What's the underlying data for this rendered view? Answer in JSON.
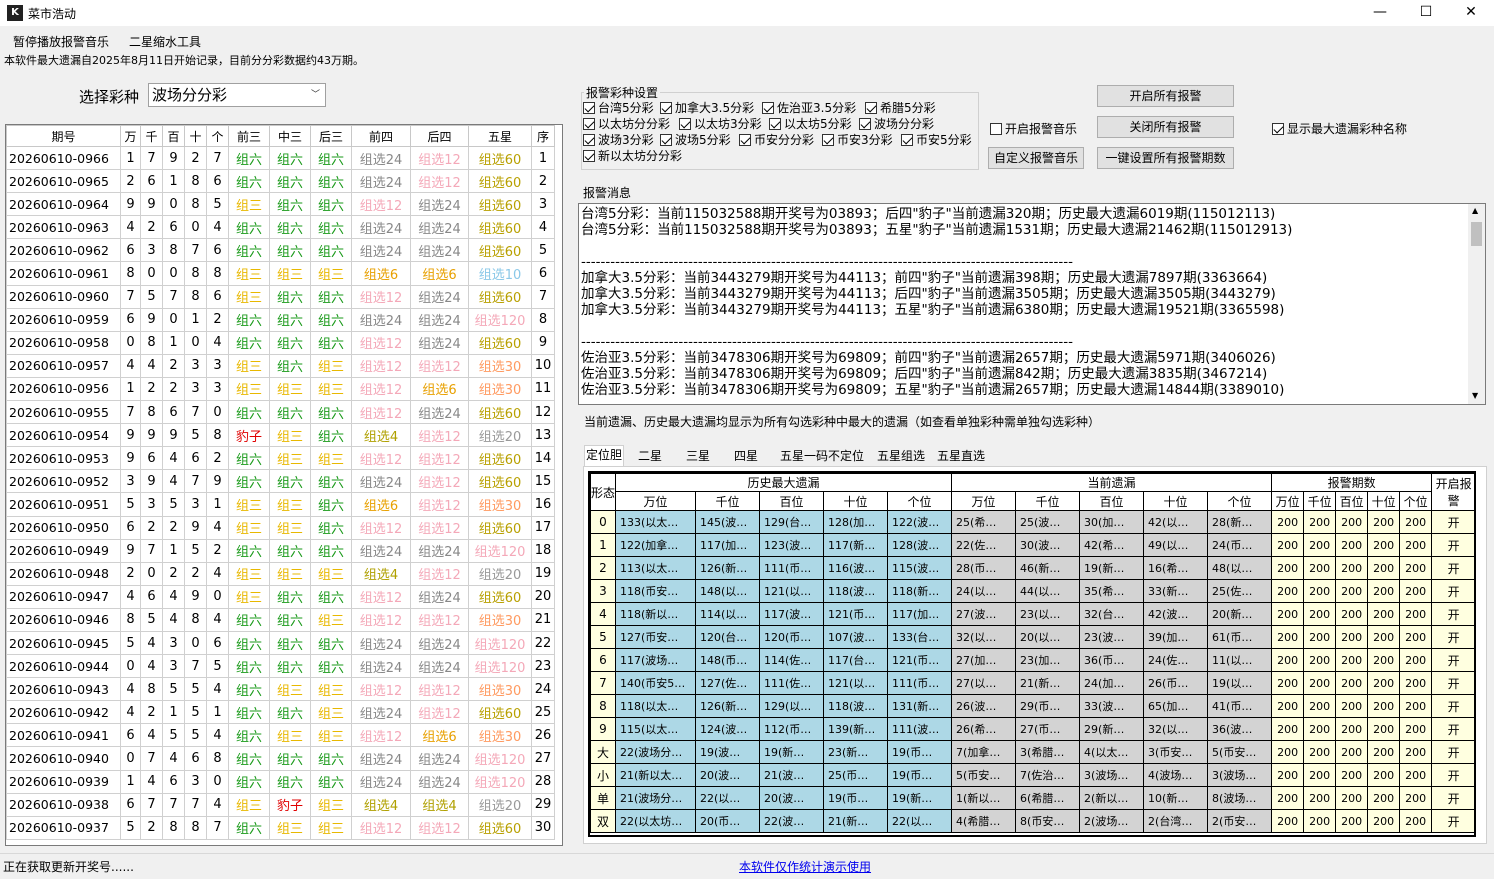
{
  "window": {
    "title": "菜市浩动",
    "minimize": "—",
    "maximize": "☐",
    "close": "✕"
  },
  "menu": [
    "暂停播放报警音乐",
    "二星缩水工具"
  ],
  "notice": "本软件最大遗漏自2025年8月11日开始记录，目前分分彩数据约43万期。",
  "selector": {
    "label": "选择彩种",
    "value": "波场分分彩"
  },
  "draws": {
    "headers": [
      "期号",
      "万",
      "千",
      "百",
      "十",
      "个",
      "前三",
      "中三",
      "后三",
      "前四",
      "后四",
      "五星",
      "序"
    ],
    "rows": [
      [
        "20260610-0966",
        "1",
        "7",
        "9",
        "2",
        "7",
        "组六",
        "组六",
        "组六",
        "组选24",
        "组选12",
        "组选60",
        "1"
      ],
      [
        "20260610-0965",
        "2",
        "6",
        "1",
        "8",
        "6",
        "组六",
        "组六",
        "组六",
        "组选24",
        "组选12",
        "组选60",
        "2"
      ],
      [
        "20260610-0964",
        "9",
        "9",
        "0",
        "8",
        "5",
        "组三",
        "组六",
        "组六",
        "组选12",
        "组选24",
        "组选60",
        "3"
      ],
      [
        "20260610-0963",
        "4",
        "2",
        "6",
        "0",
        "4",
        "组六",
        "组六",
        "组六",
        "组选24",
        "组选24",
        "组选60",
        "4"
      ],
      [
        "20260610-0962",
        "6",
        "3",
        "8",
        "7",
        "6",
        "组六",
        "组六",
        "组六",
        "组选24",
        "组选24",
        "组选60",
        "5"
      ],
      [
        "20260610-0961",
        "8",
        "0",
        "0",
        "8",
        "8",
        "组三",
        "组三",
        "组三",
        "组选6",
        "组选6",
        "组选10",
        "6"
      ],
      [
        "20260610-0960",
        "7",
        "5",
        "7",
        "8",
        "6",
        "组三",
        "组六",
        "组六",
        "组选12",
        "组选24",
        "组选60",
        "7"
      ],
      [
        "20260610-0959",
        "6",
        "9",
        "0",
        "1",
        "2",
        "组六",
        "组六",
        "组六",
        "组选24",
        "组选24",
        "组选120",
        "8"
      ],
      [
        "20260610-0958",
        "0",
        "8",
        "1",
        "0",
        "4",
        "组六",
        "组六",
        "组六",
        "组选12",
        "组选24",
        "组选60",
        "9"
      ],
      [
        "20260610-0957",
        "4",
        "4",
        "2",
        "3",
        "3",
        "组三",
        "组六",
        "组三",
        "组选12",
        "组选12",
        "组选30",
        "10"
      ],
      [
        "20260610-0956",
        "1",
        "2",
        "2",
        "3",
        "3",
        "组三",
        "组三",
        "组三",
        "组选12",
        "组选6",
        "组选30",
        "11"
      ],
      [
        "20260610-0955",
        "7",
        "8",
        "6",
        "7",
        "0",
        "组六",
        "组六",
        "组六",
        "组选12",
        "组选24",
        "组选60",
        "12"
      ],
      [
        "20260610-0954",
        "9",
        "9",
        "9",
        "5",
        "8",
        "豹子",
        "组三",
        "组六",
        "组选4",
        "组选12",
        "组选20",
        "13"
      ],
      [
        "20260610-0953",
        "9",
        "6",
        "4",
        "6",
        "2",
        "组六",
        "组三",
        "组三",
        "组选12",
        "组选12",
        "组选60",
        "14"
      ],
      [
        "20260610-0952",
        "3",
        "9",
        "4",
        "7",
        "9",
        "组六",
        "组六",
        "组六",
        "组选24",
        "组选12",
        "组选60",
        "15"
      ],
      [
        "20260610-0951",
        "5",
        "3",
        "5",
        "3",
        "1",
        "组三",
        "组三",
        "组六",
        "组选6",
        "组选12",
        "组选30",
        "16"
      ],
      [
        "20260610-0950",
        "6",
        "2",
        "2",
        "9",
        "4",
        "组三",
        "组三",
        "组六",
        "组选12",
        "组选12",
        "组选60",
        "17"
      ],
      [
        "20260610-0949",
        "9",
        "7",
        "1",
        "5",
        "2",
        "组六",
        "组六",
        "组六",
        "组选24",
        "组选24",
        "组选120",
        "18"
      ],
      [
        "20260610-0948",
        "2",
        "0",
        "2",
        "2",
        "4",
        "组三",
        "组三",
        "组三",
        "组选4",
        "组选12",
        "组选20",
        "19"
      ],
      [
        "20260610-0947",
        "4",
        "6",
        "4",
        "9",
        "0",
        "组三",
        "组六",
        "组六",
        "组选12",
        "组选24",
        "组选60",
        "20"
      ],
      [
        "20260610-0946",
        "8",
        "5",
        "4",
        "8",
        "4",
        "组六",
        "组六",
        "组三",
        "组选12",
        "组选12",
        "组选30",
        "21"
      ],
      [
        "20260610-0945",
        "5",
        "4",
        "3",
        "0",
        "6",
        "组六",
        "组六",
        "组六",
        "组选24",
        "组选24",
        "组选120",
        "22"
      ],
      [
        "20260610-0944",
        "0",
        "4",
        "3",
        "7",
        "5",
        "组六",
        "组六",
        "组六",
        "组选24",
        "组选24",
        "组选120",
        "23"
      ],
      [
        "20260610-0943",
        "4",
        "8",
        "5",
        "5",
        "4",
        "组六",
        "组三",
        "组三",
        "组选12",
        "组选12",
        "组选30",
        "24"
      ],
      [
        "20260610-0942",
        "4",
        "2",
        "1",
        "5",
        "1",
        "组六",
        "组六",
        "组三",
        "组选24",
        "组选12",
        "组选60",
        "25"
      ],
      [
        "20260610-0941",
        "6",
        "4",
        "5",
        "5",
        "4",
        "组六",
        "组三",
        "组三",
        "组选12",
        "组选6",
        "组选30",
        "26"
      ],
      [
        "20260610-0940",
        "0",
        "7",
        "4",
        "6",
        "8",
        "组六",
        "组六",
        "组六",
        "组选24",
        "组选24",
        "组选120",
        "27"
      ],
      [
        "20260610-0939",
        "1",
        "4",
        "6",
        "3",
        "0",
        "组六",
        "组六",
        "组六",
        "组选24",
        "组选24",
        "组选120",
        "28"
      ],
      [
        "20260610-0938",
        "6",
        "7",
        "7",
        "7",
        "4",
        "组三",
        "豹子",
        "组三",
        "组选4",
        "组选4",
        "组选20",
        "29"
      ],
      [
        "20260610-0937",
        "5",
        "2",
        "8",
        "8",
        "7",
        "组六",
        "组三",
        "组三",
        "组选12",
        "组选12",
        "组选60",
        "30"
      ]
    ]
  },
  "alarm_settings": {
    "legend": "报警彩种设置",
    "items": [
      {
        "label": "台湾5分彩",
        "checked": true
      },
      {
        "label": "加拿大3.5分彩",
        "checked": true
      },
      {
        "label": "佐治亚3.5分彩",
        "checked": true
      },
      {
        "label": "希腊5分彩",
        "checked": true
      },
      {
        "label": "以太坊分分彩",
        "checked": true
      },
      {
        "label": "以太坊3分彩",
        "checked": true
      },
      {
        "label": "以太坊5分彩",
        "checked": true
      },
      {
        "label": "波场分分彩",
        "checked": true
      },
      {
        "label": "波场3分彩",
        "checked": true
      },
      {
        "label": "波场5分彩",
        "checked": true
      },
      {
        "label": "币安分分彩",
        "checked": true
      },
      {
        "label": "币安3分彩",
        "checked": true
      },
      {
        "label": "币安5分彩",
        "checked": true
      },
      {
        "label": "新以太坊分分彩",
        "checked": true
      }
    ]
  },
  "controls": {
    "start_all": "开启所有报警",
    "stop_all": "关闭所有报警",
    "alarm_music": "开启报警音乐",
    "alarm_music_checked": false,
    "custom_music": "自定义报警音乐",
    "set_all_periods": "一键设置所有报警期数",
    "show_name": "显示最大遗漏彩种名称",
    "show_name_checked": true
  },
  "messages": {
    "legend": "报警消息",
    "text": "台湾5分彩：当前115032588期开奖号为03893；后四\"豹子\"当前遗漏320期；历史最大遗漏6019期(115012113)\n台湾5分彩：当前115032588期开奖号为03893；五星\"豹子\"当前遗漏1531期；历史最大遗漏21462期(115012913)\n\n-----------------------------------------------------------------------------------------------------\n加拿大3.5分彩：当前3443279期开奖号为44113；前四\"豹子\"当前遗漏398期；历史最大遗漏7897期(3363664)\n加拿大3.5分彩：当前3443279期开奖号为44113；后四\"豹子\"当前遗漏3505期；历史最大遗漏3505期(3443279)\n加拿大3.5分彩：当前3443279期开奖号为44113；五星\"豹子\"当前遗漏6380期；历史最大遗漏19521期(3365598)\n\n-----------------------------------------------------------------------------------------------------\n佐治亚3.5分彩：当前3478306期开奖号为69809；前四\"豹子\"当前遗漏2657期；历史最大遗漏5971期(3406026)\n佐治亚3.5分彩：当前3478306期开奖号为69809；后四\"豹子\"当前遗漏842期；历史最大遗漏3835期(3467214)\n佐治亚3.5分彩：当前3478306期开奖号为69809；五星\"豹子\"当前遗漏2657期；历史最大遗漏14844期(3389010)",
    "scroll_up": "▲",
    "scroll_down": "▼"
  },
  "note": "当前遗漏、历史最大遗漏均显示为所有勾选彩种中最大的遗漏（如查看单独彩种需单独勾选彩种）",
  "tabs": [
    "定位胆",
    "二星",
    "三星",
    "四星",
    "五星一码不定位",
    "五星组选",
    "五星直选"
  ],
  "miss": {
    "h_form": "形态",
    "h_hist": "历史最大遗漏",
    "h_cur": "当前遗漏",
    "h_alarm": "报警期数",
    "h_open": "开启报警",
    "positions": [
      "万位",
      "千位",
      "百位",
      "十位",
      "个位"
    ],
    "rows": [
      {
        "f": "0",
        "h": [
          "133(以太…",
          "145(波…",
          "129(台…",
          "128(加…",
          "122(波…"
        ],
        "c": [
          "25(希…",
          "25(波…",
          "30(加…",
          "42(以…",
          "28(新…"
        ]
      },
      {
        "f": "1",
        "h": [
          "122(加拿…",
          "117(加…",
          "123(波…",
          "117(新…",
          "128(波…"
        ],
        "c": [
          "22(佐…",
          "30(波…",
          "42(希…",
          "49(以…",
          "24(币…"
        ]
      },
      {
        "f": "2",
        "h": [
          "113(以太…",
          "126(新…",
          "111(币…",
          "116(波…",
          "115(波…"
        ],
        "c": [
          "28(币…",
          "46(新…",
          "19(新…",
          "16(希…",
          "48(以…"
        ]
      },
      {
        "f": "3",
        "h": [
          "118(币安…",
          "148(以…",
          "121(以…",
          "118(波…",
          "118(新…"
        ],
        "c": [
          "24(以…",
          "44(以…",
          "35(希…",
          "33(新…",
          "25(佐…"
        ]
      },
      {
        "f": "4",
        "h": [
          "118(新以…",
          "114(以…",
          "117(波…",
          "121(币…",
          "117(加…"
        ],
        "c": [
          "27(波…",
          "23(以…",
          "32(台…",
          "42(波…",
          "20(新…"
        ]
      },
      {
        "f": "5",
        "h": [
          "127(币安…",
          "120(台…",
          "120(币…",
          "107(波…",
          "133(台…"
        ],
        "c": [
          "32(以…",
          "20(以…",
          "23(波…",
          "39(加…",
          "61(币…"
        ]
      },
      {
        "f": "6",
        "h": [
          "117(波场…",
          "148(币…",
          "114(佐…",
          "117(台…",
          "121(币…"
        ],
        "c": [
          "27(加…",
          "23(加…",
          "36(币…",
          "24(佐…",
          "11(以…"
        ]
      },
      {
        "f": "7",
        "h": [
          "140(币安5…",
          "127(佐…",
          "111(佐…",
          "121(以…",
          "111(币…"
        ],
        "c": [
          "27(以…",
          "21(新…",
          "24(加…",
          "26(币…",
          "19(以…"
        ]
      },
      {
        "f": "8",
        "h": [
          "118(以太…",
          "126(新…",
          "129(以…",
          "118(波…",
          "131(新…"
        ],
        "c": [
          "26(波…",
          "29(币…",
          "33(波…",
          "65(加…",
          "41(币…"
        ]
      },
      {
        "f": "9",
        "h": [
          "115(以太…",
          "124(波…",
          "112(币…",
          "139(新…",
          "111(波…"
        ],
        "c": [
          "26(希…",
          "27(币…",
          "29(新…",
          "32(以…",
          "36(波…"
        ]
      },
      {
        "f": "大",
        "h": [
          "22(波场分…",
          "19(波…",
          "19(新…",
          "23(新…",
          "19(币…"
        ],
        "c": [
          "7(加拿…",
          "3(希腊…",
          "4(以太…",
          "3(币安…",
          "5(币安…"
        ]
      },
      {
        "f": "小",
        "h": [
          "21(新以太…",
          "20(波…",
          "21(波…",
          "25(币…",
          "19(币…"
        ],
        "c": [
          "5(币安…",
          "7(佐治…",
          "3(波场…",
          "4(波场…",
          "3(波场…"
        ]
      },
      {
        "f": "单",
        "h": [
          "21(波场分…",
          "22(以…",
          "20(波…",
          "19(币…",
          "19(新…"
        ],
        "c": [
          "1(新以…",
          "6(希腊…",
          "2(新以…",
          "10(新…",
          "8(波场…"
        ]
      },
      {
        "f": "双",
        "h": [
          "22(以太坊…",
          "20(币…",
          "22(波…",
          "21(新…",
          "22(以…"
        ],
        "c": [
          "4(希腊…",
          "8(币安…",
          "2(波场…",
          "2(台湾…",
          "2(币安…"
        ]
      }
    ],
    "alarm_value": "200",
    "open_label": "开"
  },
  "status": {
    "text": "正在获取更新开奖号......",
    "link": "本软件仅作统计演示使用"
  }
}
